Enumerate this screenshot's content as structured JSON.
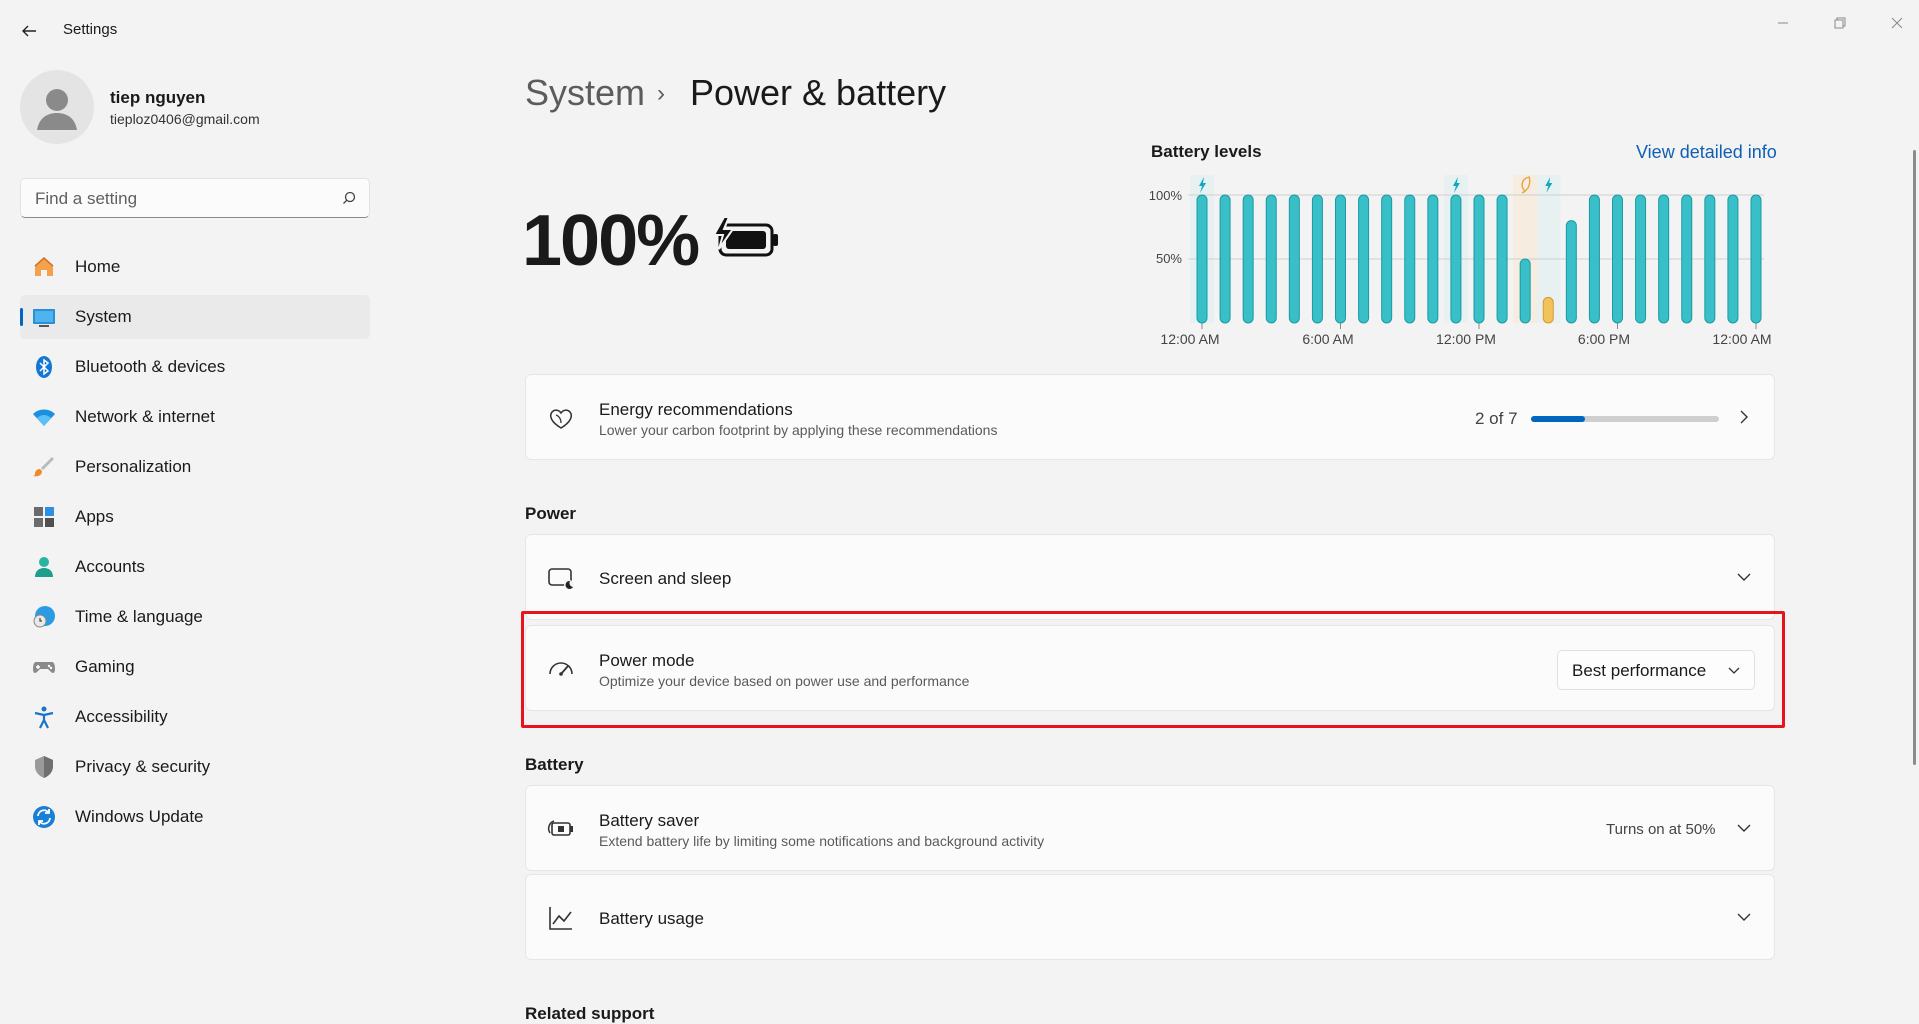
{
  "window": {
    "title": "Settings"
  },
  "profile": {
    "name": "tiep nguyen",
    "email": "tieploz0406@gmail.com"
  },
  "search": {
    "placeholder": "Find a setting"
  },
  "nav": [
    {
      "label": "Home",
      "icon": "home-icon",
      "active": false
    },
    {
      "label": "System",
      "icon": "system-icon",
      "active": true
    },
    {
      "label": "Bluetooth & devices",
      "icon": "bluetooth-icon",
      "active": false
    },
    {
      "label": "Network & internet",
      "icon": "wifi-icon",
      "active": false
    },
    {
      "label": "Personalization",
      "icon": "brush-icon",
      "active": false
    },
    {
      "label": "Apps",
      "icon": "apps-icon",
      "active": false
    },
    {
      "label": "Accounts",
      "icon": "accounts-icon",
      "active": false
    },
    {
      "label": "Time & language",
      "icon": "time-language-icon",
      "active": false
    },
    {
      "label": "Gaming",
      "icon": "gamepad-icon",
      "active": false
    },
    {
      "label": "Accessibility",
      "icon": "accessibility-icon",
      "active": false
    },
    {
      "label": "Privacy & security",
      "icon": "shield-icon",
      "active": false
    },
    {
      "label": "Windows Update",
      "icon": "update-icon",
      "active": false
    }
  ],
  "breadcrumb": {
    "parent": "System",
    "separator": "›",
    "page": "Power & battery"
  },
  "battery": {
    "percent": "100%"
  },
  "chart": {
    "title": "Battery levels",
    "link": "View detailed info",
    "y_ticks": [
      "100%",
      "50%"
    ],
    "x_ticks": [
      "12:00 AM",
      "6:00 AM",
      "12:00 PM",
      "6:00 PM",
      "12:00 AM"
    ]
  },
  "chart_data": {
    "type": "bar",
    "title": "Battery levels",
    "ylim": [
      0,
      100
    ],
    "y_ticks": [
      "100%",
      "50%"
    ],
    "x_ticks": [
      "12:00 AM",
      "6:00 AM",
      "12:00 PM",
      "6:00 PM",
      "12:00 AM"
    ],
    "values": [
      100,
      100,
      100,
      100,
      100,
      100,
      100,
      100,
      100,
      100,
      100,
      100,
      100,
      100,
      50,
      20,
      80,
      100,
      100,
      100,
      100,
      100,
      100,
      100,
      100
    ],
    "battery_saver_bars": [
      15
    ],
    "charging_markers": [
      0,
      11,
      15
    ],
    "saver_markers": [
      14
    ],
    "colors": {
      "bar": "#39bfc8",
      "bar_outline": "#1b9aa3",
      "saver_bar": "#f2c25b",
      "charging": "#12a9c0",
      "saver": "#e8a33c"
    }
  },
  "energy": {
    "title": "Energy recommendations",
    "subtitle": "Lower your carbon footprint by applying these recommendations",
    "progress_text": "2 of 7",
    "progress": 0.2857
  },
  "sections": {
    "power": "Power",
    "battery": "Battery",
    "related": "Related support"
  },
  "power_items": {
    "screen_sleep": {
      "title": "Screen and sleep"
    },
    "power_mode": {
      "title": "Power mode",
      "subtitle": "Optimize your device based on power use and performance",
      "value": "Best performance"
    }
  },
  "battery_items": {
    "saver": {
      "title": "Battery saver",
      "subtitle": "Extend battery life by limiting some notifications and background activity",
      "status": "Turns on at 50%"
    },
    "usage": {
      "title": "Battery usage"
    }
  },
  "colors": {
    "accent": "#0067c0",
    "highlight": "#e8141c",
    "link": "#0f5fb3"
  }
}
